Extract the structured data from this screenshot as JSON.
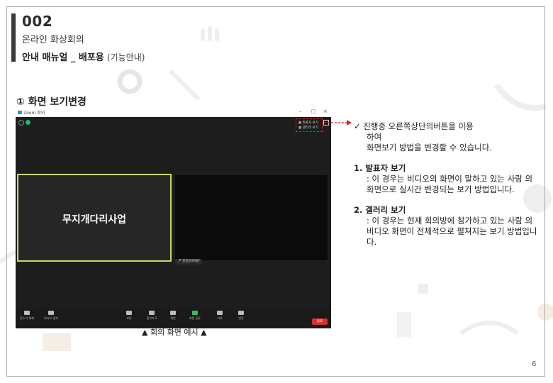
{
  "header": {
    "number": "002",
    "subtitle": "온라인 화상회의",
    "title_bold": "안내 매뉴얼 _ 배포용",
    "title_light": "(기능안내)"
  },
  "section_title": "① 화면 보기변경",
  "zoom": {
    "window_title": "Zoom 회의",
    "min_label": "–",
    "max_label": "□",
    "close_label": "×",
    "view_speaker": "발표자 보기",
    "view_gallery": "갤러리 보기",
    "main_participant": "무지개다리사업",
    "second_participant": "쟁점문화재단",
    "toolbar": {
      "mute": "음소거 해제",
      "video": "비디오 중지",
      "security": "보안",
      "participants": "참가자",
      "participants_count": "2",
      "chat": "채팅",
      "share": "화면 공유",
      "record": "기록",
      "reactions": "반응",
      "end": "종료"
    }
  },
  "caption": "▲ 회의 화면 예시 ▲",
  "description": {
    "intro_1": "✓ 진행중 오른쪽상단의버튼을  이용",
    "intro_2": "하여",
    "intro_3": "화면보기 방법을 변경할 수 있습니다.",
    "item1_title": "1.  발표자 보기",
    "item1_text": ": 이 경우는 비디오의 화면이 말하고 있는 사람 의 화면으로 실시간 변경되는 보기 방법입니다.",
    "item2_title": "2. 갤러리 보기",
    "item2_text": ": 이 경우는 현재 회의방에 참가하고 있는 사람 의 비디오 화면이 전체적으로 펼쳐지는 보기 방법입니다."
  },
  "page_number": "6",
  "colors": {
    "accent_red": "#e02020",
    "speaker_border": "#c9d66a",
    "zoom_bg": "#1d1d1d"
  }
}
